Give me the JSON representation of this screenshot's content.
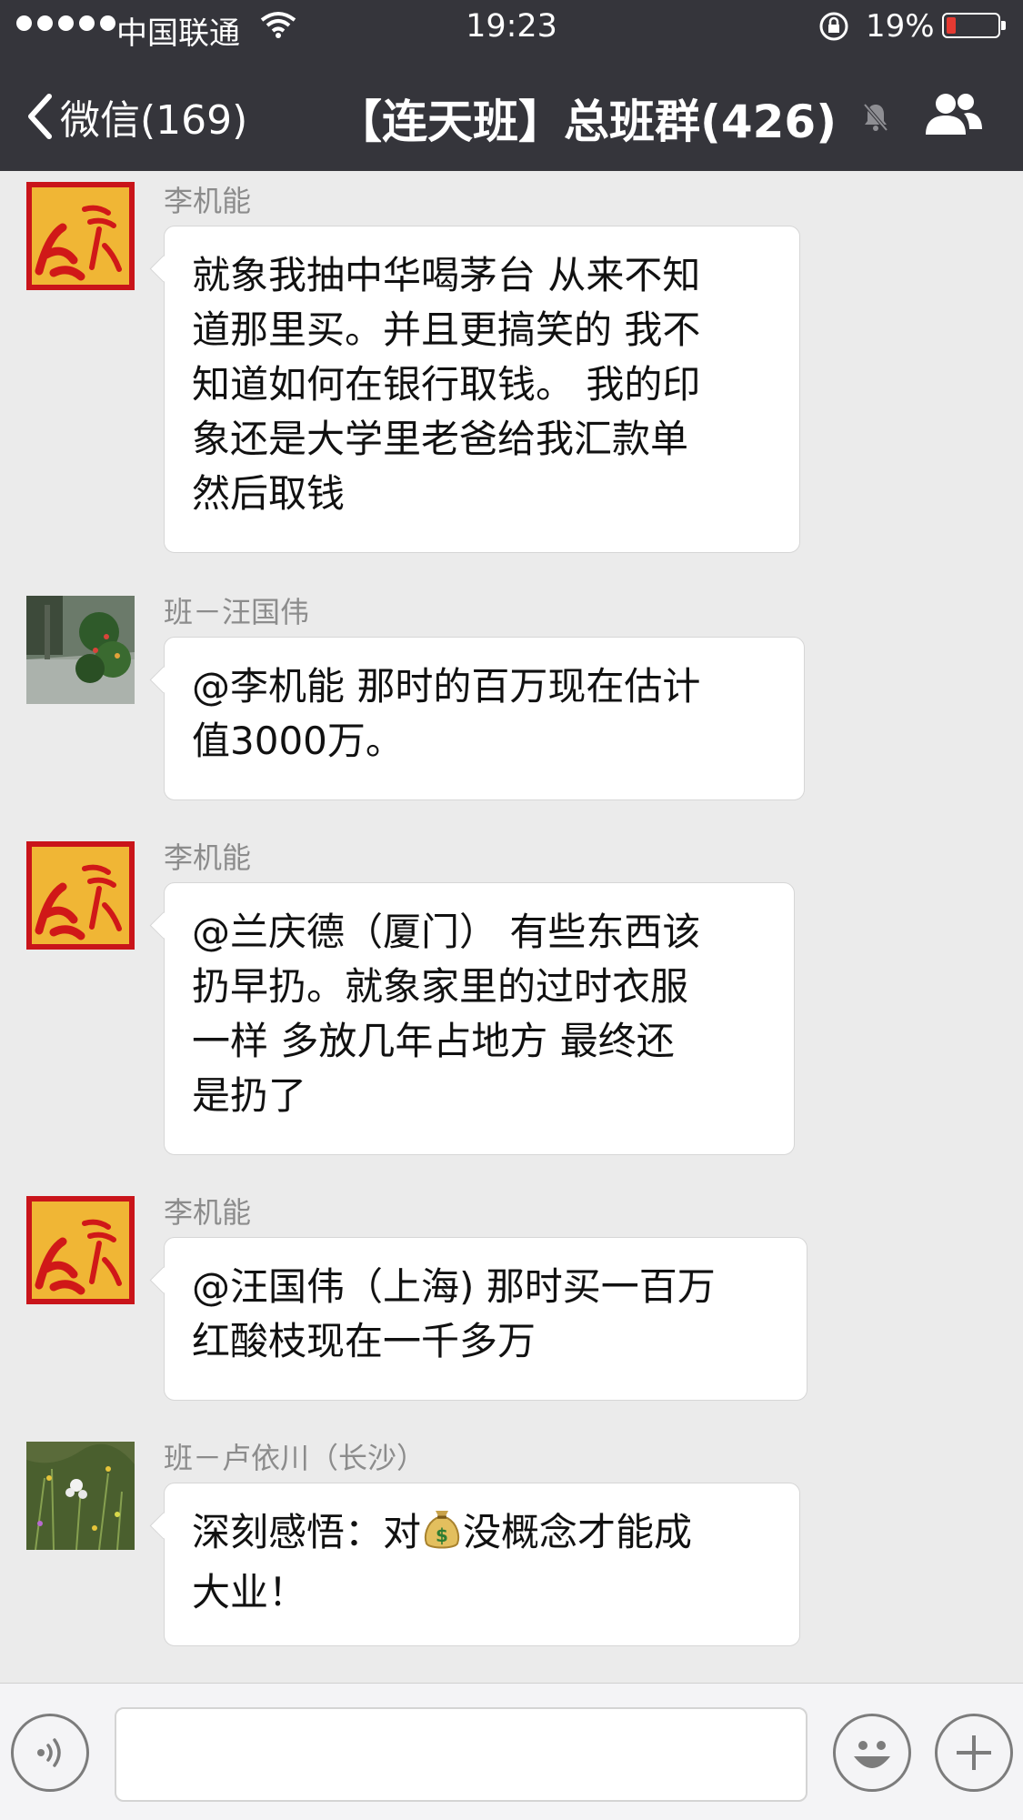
{
  "status_bar": {
    "carrier": "中国联通",
    "time": "19:23",
    "battery_percent": "19%",
    "battery_level": 0.19,
    "icons": [
      "signal-dots-icon",
      "wifi-icon",
      "rotation-lock-icon",
      "battery-icon"
    ]
  },
  "nav": {
    "back_label": "微信(169)",
    "title": "【连天班】总班群(426)",
    "icons": [
      "back-chevron-icon",
      "mute-icon",
      "group-members-icon"
    ]
  },
  "messages": [
    {
      "sender": "李机能",
      "avatar": "red-calligraphy-avatar",
      "lines": [
        "就象我抽中华喝茅台 从来不知",
        "道那里买。并且更搞笑的 我不",
        "知道如何在银行取钱。 我的印",
        "象还是大学里老爸给我汇款单",
        "然后取钱"
      ]
    },
    {
      "sender": "班－汪国伟",
      "avatar": "rainy-garden-avatar",
      "lines": [
        "@李机能  那时的百万现在估计",
        "值3000万。"
      ]
    },
    {
      "sender": "李机能",
      "avatar": "red-calligraphy-avatar",
      "lines": [
        "@兰庆德（厦门） 有些东西该",
        "扔早扔。就象家里的过时衣服",
        "一样  多放几年占地方  最终还",
        "是扔了"
      ]
    },
    {
      "sender": "李机能",
      "avatar": "red-calligraphy-avatar",
      "lines": [
        "@汪国伟（上海) 那时买一百万",
        "红酸枝现在一千多万"
      ]
    },
    {
      "sender": "班－卢依川（长沙）",
      "avatar": "wildflower-meadow-avatar",
      "line1_before": "深刻感悟：对",
      "line1_after": "没概念才能成",
      "line2": "大业！",
      "emoji": "money-bag-icon"
    }
  ],
  "input_bar": {
    "icons": [
      "voice-icon",
      "emoji-icon",
      "plus-icon"
    ],
    "input_value": ""
  },
  "colors": {
    "header_bg": "#35353b",
    "chat_bg": "#ebebeb",
    "bubble_bg": "#ffffff",
    "sender_text": "#8c8c8c",
    "battery_low": "#e53a32"
  }
}
